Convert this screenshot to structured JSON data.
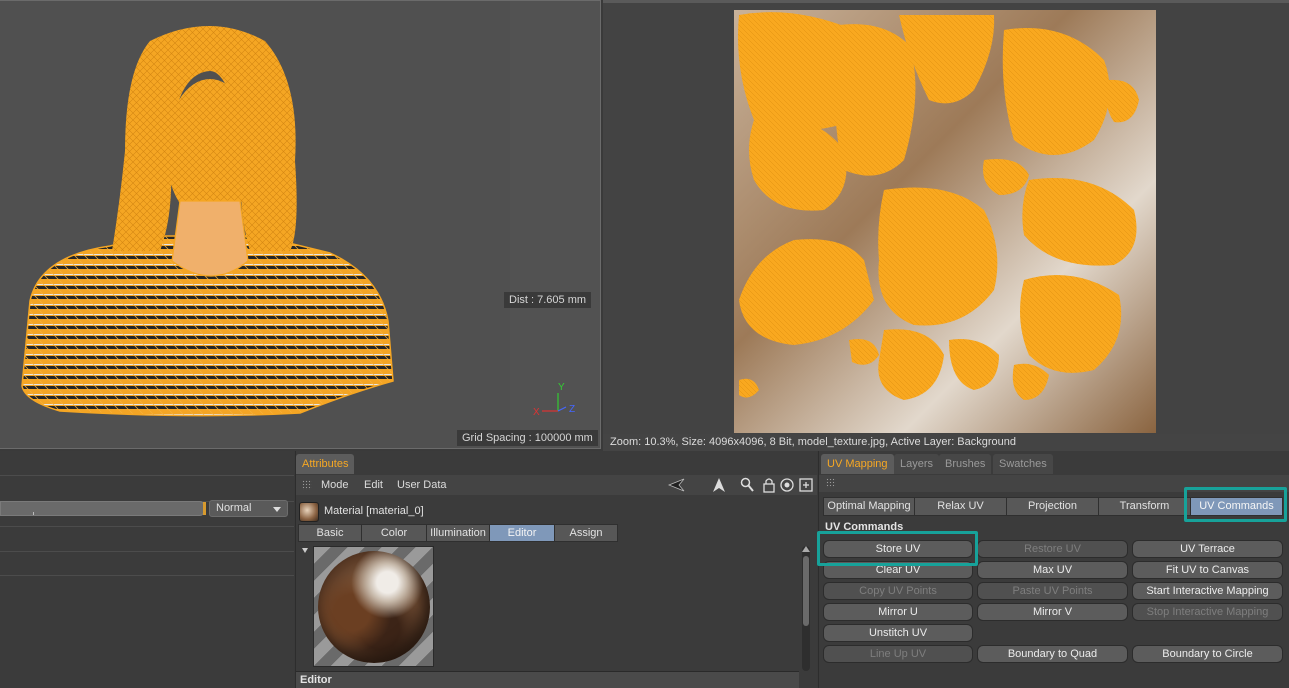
{
  "viewport3d": {
    "dist_label": "Dist : 7.605 mm",
    "grid_label": "Grid Spacing : 100000 mm",
    "axis_y": "Y",
    "axis_x": "X",
    "axis_z": "Z",
    "wire_color": "#f7a823"
  },
  "uv_view": {
    "status": "Zoom: 10.3%, Size: 4096x4096, 8 Bit, model_texture.jpg, Active Layer: Background",
    "island_color": "#f9a81f"
  },
  "left_panel": {
    "blend_mode": "Normal"
  },
  "attributes": {
    "tab_label": "Attributes",
    "menu": [
      "Mode",
      "Edit",
      "User Data"
    ],
    "material_name": "Material [material_0]",
    "segments": [
      "Basic",
      "Color",
      "Illumination",
      "Editor",
      "Assign"
    ],
    "active_segment": "Editor",
    "footer": "Editor",
    "icons": [
      "back-arrow-icon",
      "pointer-icon",
      "search-icon",
      "lock-icon",
      "target-icon",
      "new-panel-icon"
    ]
  },
  "uv_panel": {
    "tabs": [
      "UV Mapping",
      "Layers",
      "Brushes",
      "Swatches"
    ],
    "active_tab": "UV Mapping",
    "subtabs": [
      "Optimal Mapping",
      "Relax UV",
      "Projection",
      "Transform",
      "UV Commands"
    ],
    "active_subtab": "UV Commands",
    "section_title": "UV Commands",
    "commands": {
      "store_uv": "Store UV",
      "restore_uv": "Restore UV",
      "uv_terrace": "UV Terrace",
      "clear_uv": "Clear UV",
      "max_uv": "Max UV",
      "fit_uv_to_canvas": "Fit UV to Canvas",
      "copy_uv_points": "Copy UV Points",
      "paste_uv_points": "Paste UV Points",
      "start_interactive_mapping": "Start Interactive Mapping",
      "mirror_u": "Mirror U",
      "mirror_v": "Mirror V",
      "stop_interactive_mapping": "Stop Interactive Mapping",
      "unstitch_uv": "Unstitch UV",
      "line_up_uv": "Line Up UV",
      "boundary_to_quad": "Boundary to Quad",
      "boundary_to_circle": "Boundary to Circle"
    },
    "highlight_color": "#17a29a"
  }
}
